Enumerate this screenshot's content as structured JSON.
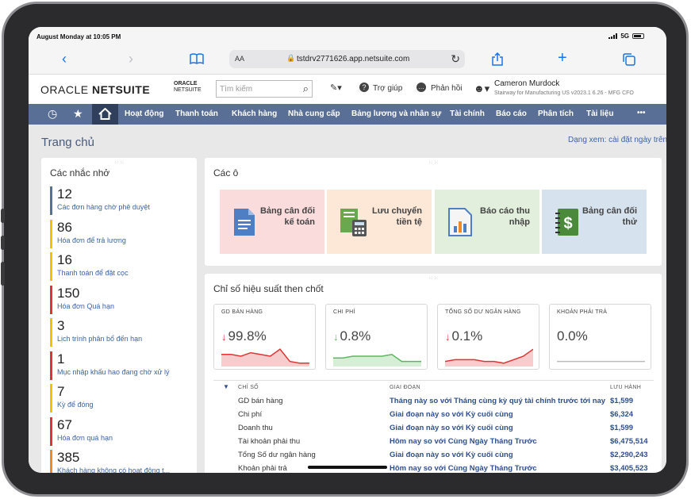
{
  "status_bar": {
    "time": "August Monday at 10:05 PM",
    "network": "5G"
  },
  "browser": {
    "text_size_label": "AA",
    "url": "tstdrv2771626.app.netsuite.com",
    "icons": [
      "back-icon",
      "forward-icon",
      "bookmarks-icon",
      "lock-icon",
      "reload-icon",
      "share-icon",
      "new-tab-icon",
      "tabs-icon"
    ]
  },
  "header": {
    "logo_oracle": "ORACLE",
    "logo_netsuite": "NETSUITE",
    "small_logo_line1": "ORACLE",
    "small_logo_line2": "NETSUITE",
    "search_placeholder": "Tìm kiếm",
    "help_label": "Trợ giúp",
    "feedback_label": "Phản hồi",
    "user_name": "Cameron Murdock",
    "user_role": "Stairway for Manufacturing US v2023.1 6.26 - MFG CFO"
  },
  "nav": {
    "items": [
      "Hoạt động",
      "Thanh toán",
      "Khách hàng",
      "Nhà cung cấp",
      "Bảng lương và nhân sự",
      "Tài chính",
      "Báo cáo",
      "Phân tích",
      "Tài liệu"
    ],
    "more": "•••"
  },
  "page": {
    "title": "Trang chủ",
    "view_link": "Dạng xem: cài đặt ngày trên"
  },
  "reminders": {
    "title": "Các nhắc nhở",
    "items": [
      {
        "count": "12",
        "label": "Các đơn hàng chờ phê duyệt",
        "color": "#5a6f95"
      },
      {
        "count": "86",
        "label": "Hóa đơn để trả lương",
        "color": "#f2c200"
      },
      {
        "count": "16",
        "label": "Thanh toán để đặt cọc",
        "color": "#f2c200"
      },
      {
        "count": "150",
        "label": "Hóa đơn Quá hạn",
        "color": "#e03434"
      },
      {
        "count": "3",
        "label": "Lịch trình phân bổ đến hạn",
        "color": "#f2c200"
      },
      {
        "count": "1",
        "label": "Mục nhập khấu hao đang chờ xử lý",
        "color": "#e03434"
      },
      {
        "count": "7",
        "label": "Kỳ để đóng",
        "color": "#f2c200"
      },
      {
        "count": "67",
        "label": "Hóa đơn quá hạn",
        "color": "#e03434"
      },
      {
        "count": "385",
        "label": "Khách hàng không có hoạt động t...",
        "color": "#f08a24"
      }
    ]
  },
  "tiles": {
    "title": "Các ô",
    "items": [
      {
        "label": "Bảng cân đối kế toán",
        "bg": "#fbdcdc",
        "icon": "document-icon"
      },
      {
        "label": "Lưu chuyển tiền tệ",
        "bg": "#fde7d6",
        "icon": "calculator-icon"
      },
      {
        "label": "Báo cáo thu nhập",
        "bg": "#e2efdc",
        "icon": "report-chart-icon"
      },
      {
        "label": "Bảng cân đối thử",
        "bg": "#d7e2ef",
        "icon": "dollar-book-icon"
      }
    ]
  },
  "kpi": {
    "title": "Chỉ số hiệu suất then chốt",
    "cards": [
      {
        "name": "GD BÁN HÀNG",
        "value": "99.8%",
        "direction": "down",
        "color": "#e03434",
        "spark": [
          6,
          6,
          5,
          7,
          6,
          5,
          9,
          2,
          1,
          1
        ]
      },
      {
        "name": "CHI PHÍ",
        "value": "0.8%",
        "direction": "down",
        "color": "#5cb85c",
        "spark": [
          4,
          4,
          5,
          5,
          5,
          5,
          6,
          2,
          2,
          2
        ]
      },
      {
        "name": "TỔNG SỐ DƯ NGÂN HÀNG",
        "value": "0.1%",
        "direction": "down",
        "color": "#e03434",
        "spark": [
          2,
          3,
          3,
          3,
          2,
          2,
          1,
          3,
          5,
          9
        ]
      },
      {
        "name": "KHOẢN PHẢI TRẢ",
        "value": "0.0%",
        "direction": "none",
        "color": "#bbbbbb",
        "spark": [
          2,
          2,
          2,
          2,
          2,
          2,
          2,
          2,
          2,
          2
        ]
      }
    ],
    "table": {
      "headers": {
        "index": "CHỈ SỐ",
        "period": "GIAI ĐOẠN",
        "current": "LƯU HÀNH"
      },
      "rows": [
        {
          "index": "GD bán hàng",
          "period": "Tháng này so với Tháng cùng kỳ quý tài chính trước tới nay",
          "current": "$1,599"
        },
        {
          "index": "Chi phí",
          "period": "Giai đoạn này so với Kỳ cuối cùng",
          "current": "$6,324"
        },
        {
          "index": "Doanh thu",
          "period": "Giai đoạn này so với Kỳ cuối cùng",
          "current": "$1,599"
        },
        {
          "index": "Tài khoản phải thu",
          "period": "Hôm nay so với Cùng Ngày Tháng Trước",
          "current": "$6,475,514"
        },
        {
          "index": "Tổng Số dư ngân hàng",
          "period": "Giai đoạn này so với Kỳ cuối cùng",
          "current": "$2,290,243"
        },
        {
          "index": "Khoản phải trả",
          "period": "Hôm nay so với Cùng Ngày Tháng Trước",
          "current": "$3,405,523"
        }
      ]
    }
  }
}
